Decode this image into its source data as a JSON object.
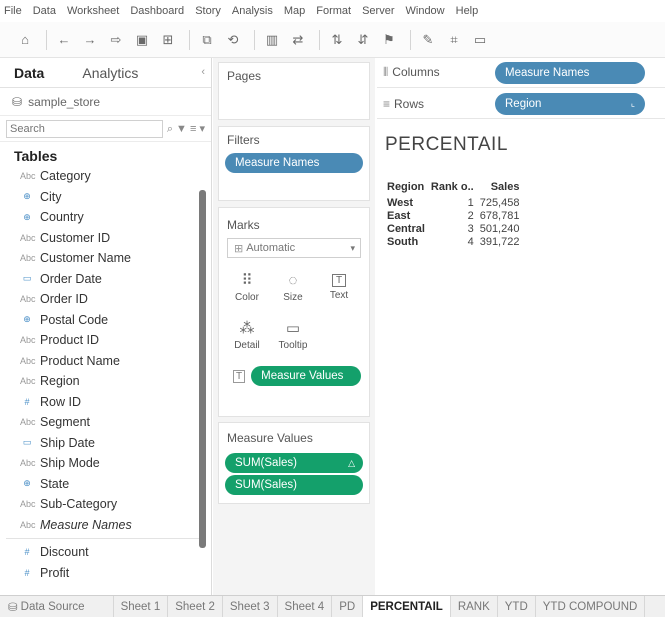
{
  "menu": [
    "File",
    "Data",
    "Worksheet",
    "Dashboard",
    "Story",
    "Analysis",
    "Map",
    "Format",
    "Server",
    "Window",
    "Help"
  ],
  "toolbar_icons": [
    "home-icon",
    "back-icon",
    "forward-icon",
    "redo-icon",
    "save-icon",
    "add-datasource-icon",
    "new-sheet-icon",
    "undo-icon",
    "bar-chart-icon",
    "swap-icon",
    "sort-asc-icon",
    "sort-desc-icon",
    "highlight-icon",
    "pin-icon",
    "label-icon",
    "present-icon"
  ],
  "data_pane": {
    "tab_data": "Data",
    "tab_analytics": "Analytics",
    "collapse": "‹",
    "source": "sample_store",
    "search_placeholder": "Search",
    "search_tools": "⌕ ▼ ≡ ▾",
    "tables_heading": "Tables",
    "dimensions": [
      {
        "name": "Category",
        "icon": "Abc"
      },
      {
        "name": "City",
        "icon": "⊕"
      },
      {
        "name": "Country",
        "icon": "⊕"
      },
      {
        "name": "Customer ID",
        "icon": "Abc"
      },
      {
        "name": "Customer Name",
        "icon": "Abc"
      },
      {
        "name": "Order Date",
        "icon": "▭"
      },
      {
        "name": "Order ID",
        "icon": "Abc"
      },
      {
        "name": "Postal Code",
        "icon": "⊕"
      },
      {
        "name": "Product ID",
        "icon": "Abc"
      },
      {
        "name": "Product Name",
        "icon": "Abc"
      },
      {
        "name": "Region",
        "icon": "Abc"
      },
      {
        "name": "Row ID",
        "icon": "#"
      },
      {
        "name": "Segment",
        "icon": "Abc"
      },
      {
        "name": "Ship Date",
        "icon": "▭"
      },
      {
        "name": "Ship Mode",
        "icon": "Abc"
      },
      {
        "name": "State",
        "icon": "⊕"
      },
      {
        "name": "Sub-Category",
        "icon": "Abc"
      },
      {
        "name": "Measure Names",
        "icon": "Abc"
      }
    ],
    "measures": [
      {
        "name": "Discount",
        "icon": "#"
      },
      {
        "name": "Profit",
        "icon": "#"
      }
    ]
  },
  "cards": {
    "pages_title": "Pages",
    "filters_title": "Filters",
    "filters_pill": "Measure Names",
    "marks_title": "Marks",
    "marks_type": "Automatic",
    "mark_buttons": [
      {
        "label": "Color",
        "glyph": "⠿"
      },
      {
        "label": "Size",
        "glyph": "◌"
      },
      {
        "label": "Text",
        "glyph": "T"
      },
      {
        "label": "Detail",
        "glyph": "⁂"
      },
      {
        "label": "Tooltip",
        "glyph": "▭"
      }
    ],
    "marks_pill": "Measure Values",
    "measure_values_title": "Measure Values",
    "measure_values_pills": [
      "SUM(Sales)",
      "SUM(Sales)"
    ]
  },
  "shelves": {
    "columns_label": "Columns",
    "columns_pill": "Measure Names",
    "rows_label": "Rows",
    "rows_pill": "Region"
  },
  "view": {
    "title": "PERCENTAIL",
    "headers": [
      "Region",
      "Rank o..",
      "Sales"
    ],
    "rows": [
      [
        "West",
        "1",
        "725,458"
      ],
      [
        "East",
        "2",
        "678,781"
      ],
      [
        "Central",
        "3",
        "501,240"
      ],
      [
        "South",
        "4",
        "391,722"
      ]
    ]
  },
  "sheet_tabs": {
    "data_source": "Data Source",
    "tabs": [
      "Sheet 1",
      "Sheet 2",
      "Sheet 3",
      "Sheet 4",
      "PD",
      "PERCENTAIL",
      "RANK",
      "YTD",
      "YTD COMPOUND"
    ],
    "active": "PERCENTAIL"
  },
  "colors": {
    "blue_pill": "#4a8ab5",
    "green_pill": "#14a06b"
  }
}
